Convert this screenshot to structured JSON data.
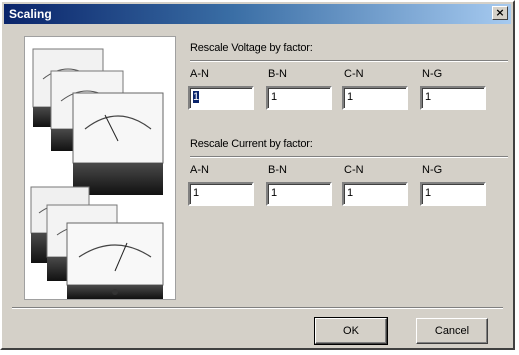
{
  "window": {
    "title": "Scaling",
    "close_glyph": "×"
  },
  "voltage": {
    "label": "Rescale Voltage by factor:",
    "columns": [
      "A-N",
      "B-N",
      "C-N",
      "N-G"
    ],
    "values": [
      "1",
      "1",
      "1",
      "1"
    ]
  },
  "current": {
    "label": "Rescale Current by factor:",
    "columns": [
      "A-N",
      "B-N",
      "C-N",
      "N-G"
    ],
    "values": [
      "1",
      "1",
      "1",
      "1"
    ]
  },
  "buttons": {
    "ok": "OK",
    "cancel": "Cancel"
  },
  "image": {
    "icon": "analog-meters-image"
  }
}
